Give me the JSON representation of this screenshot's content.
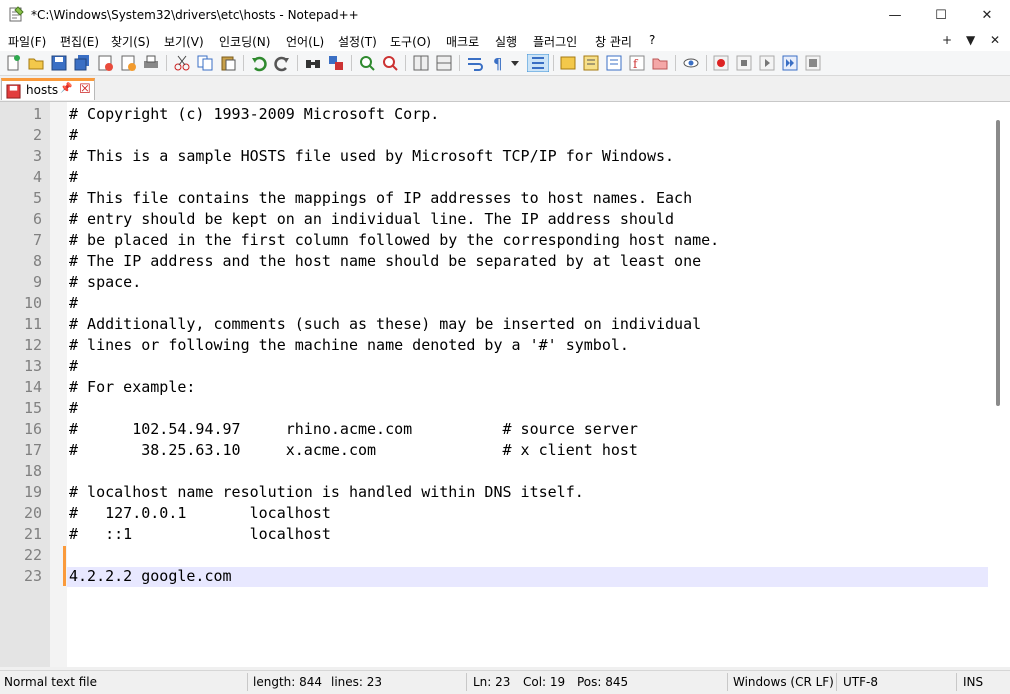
{
  "window": {
    "title": "*C:\\Windows\\System32\\drivers\\etc\\hosts - Notepad++",
    "minimize_glyph": "—",
    "maximize_glyph": "☐",
    "close_glyph": "✕"
  },
  "menu": {
    "items": [
      "파일(F)",
      "편집(E)",
      "찾기(S)",
      "보기(V)",
      "인코딩(N)",
      "언어(L)",
      "설정(T)",
      "도구(O)",
      "매크로",
      "실행",
      "플러그인",
      "창 관리",
      "?"
    ],
    "right": [
      "+",
      "▼",
      "✕"
    ]
  },
  "tab": {
    "label": "hosts",
    "pin_glyph": "📌",
    "close_glyph": "☒"
  },
  "editor": {
    "line_numbers": [
      "1",
      "2",
      "3",
      "4",
      "5",
      "6",
      "7",
      "8",
      "9",
      "10",
      "11",
      "12",
      "13",
      "14",
      "15",
      "16",
      "17",
      "18",
      "19",
      "20",
      "21",
      "22",
      "23"
    ],
    "lines": [
      "# Copyright (c) 1993-2009 Microsoft Corp.",
      "#",
      "# This is a sample HOSTS file used by Microsoft TCP/IP for Windows.",
      "#",
      "# This file contains the mappings of IP addresses to host names. Each",
      "# entry should be kept on an individual line. The IP address should",
      "# be placed in the first column followed by the corresponding host name.",
      "# The IP address and the host name should be separated by at least one",
      "# space.",
      "#",
      "# Additionally, comments (such as these) may be inserted on individual",
      "# lines or following the machine name denoted by a '#' symbol.",
      "#",
      "# For example:",
      "#",
      "#      102.54.94.97     rhino.acme.com          # source server",
      "#       38.25.63.10     x.acme.com              # x client host",
      "",
      "# localhost name resolution is handled within DNS itself.",
      "#   127.0.0.1       localhost",
      "#   ::1             localhost",
      "",
      "4.2.2.2 google.com"
    ]
  },
  "statusbar": {
    "file_type": "Normal text file",
    "length": "length: 844",
    "lines": "lines: 23",
    "ln": "Ln: 23",
    "col": "Col: 19",
    "pos": "Pos: 845",
    "eol": "Windows (CR LF)",
    "encoding": "UTF-8",
    "mode": "INS"
  },
  "colors": {
    "accent_tab": "#fa9a3b",
    "current_line": "#e8e8ff",
    "gutter": "#e4e4e4"
  }
}
